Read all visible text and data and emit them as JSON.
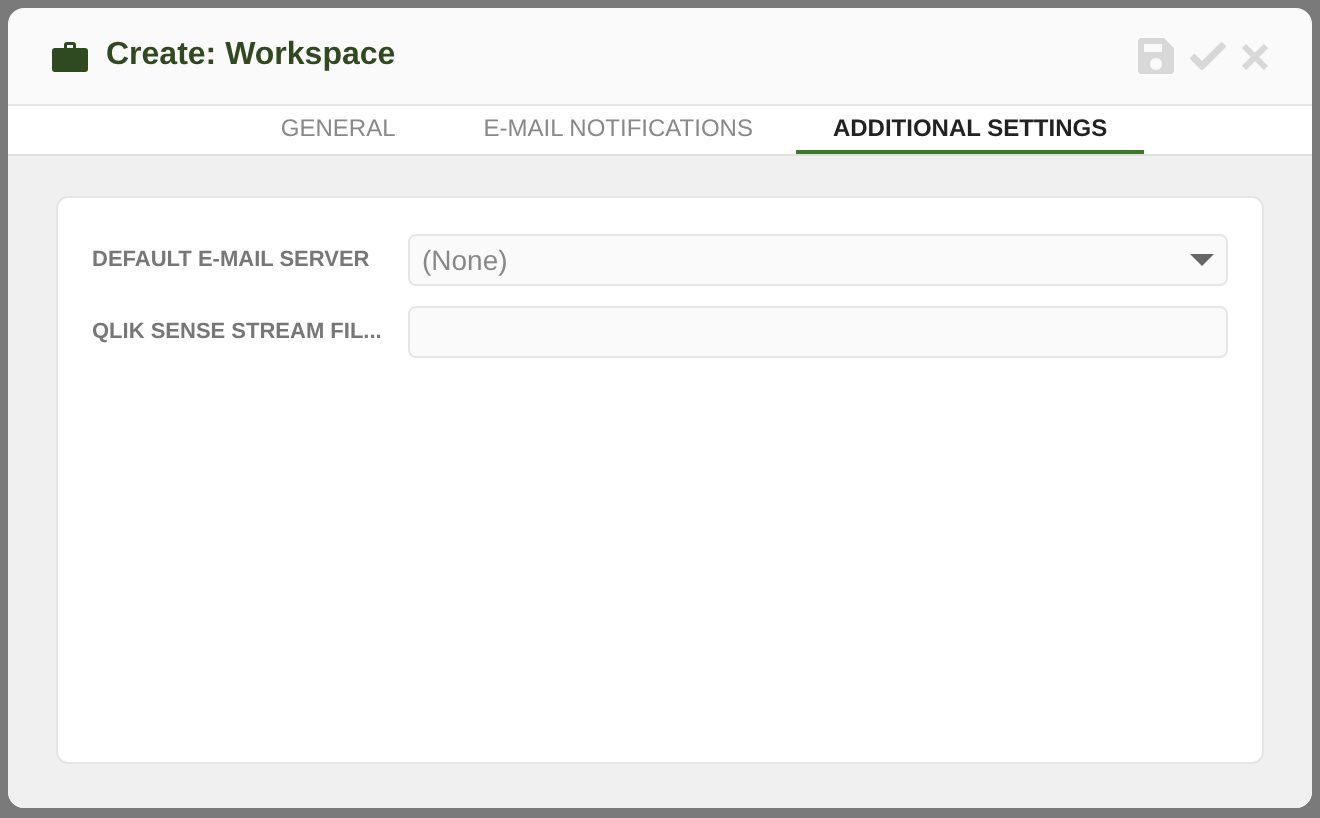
{
  "window": {
    "title": "Create: Workspace"
  },
  "tabs": [
    {
      "label": "GENERAL",
      "selected": false
    },
    {
      "label": "E-MAIL NOTIFICATIONS",
      "selected": false
    },
    {
      "label": "ADDITIONAL SETTINGS",
      "selected": true
    }
  ],
  "fields": [
    {
      "kind": "select",
      "label": "DEFAULT E-MAIL SERVER",
      "value": "(None)"
    },
    {
      "kind": "text",
      "label": "QLIK SENSE STREAM FIL..."
    }
  ]
}
